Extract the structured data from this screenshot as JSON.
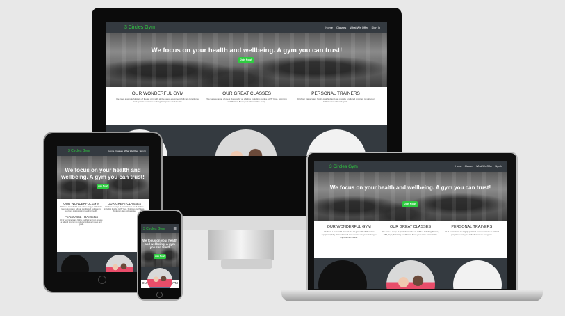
{
  "site": {
    "brand": "3 Circles Gym",
    "nav": [
      "Home",
      "Classes",
      "What We Offer",
      "Sign In"
    ],
    "hero_title": "We focus on your health and wellbeing. A gym you can trust!",
    "hero_title_tablet_line1": "We focus on your health and",
    "hero_title_tablet_line2": "wellbeing. A gym you can trust!",
    "hero_title_phone": "We focus on your health and wellbeing. A gym you can trust!",
    "join_label": "Join Now!",
    "sections": [
      {
        "title": "OUR WONDERFUL GYM",
        "text": "We have a wonderful state of the art gym with all the latest equipment, fully air conditioned and open to everyone looking to improve their health."
      },
      {
        "title": "OUR GREAT CLASSES",
        "text": "We have a range of great classes for all abilities including Zumba, HIIT, Yoga, Spinning and Pilates. Book your class online today."
      },
      {
        "title": "PERSONAL TRAINERS",
        "text": "All of our trainers are highly qualified and can provide a tailored program to suit your individual needs and goals."
      }
    ]
  },
  "colors": {
    "accent": "#2ecc40",
    "nav_bg": "#343a40"
  }
}
